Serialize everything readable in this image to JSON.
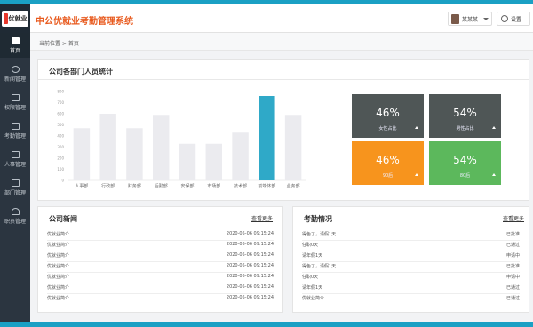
{
  "app": {
    "logo_text": "优就业",
    "title": "中公优就业考勤管理系统"
  },
  "header": {
    "user_name": "某某某",
    "settings_label": "设置"
  },
  "sidebar": {
    "items": [
      {
        "label": "首页",
        "icon": "home-icon",
        "active": true
      },
      {
        "label": "新闻管理",
        "icon": "globe-icon"
      },
      {
        "label": "权限管理",
        "icon": "lock-icon"
      },
      {
        "label": "考勤管理",
        "icon": "calendar-icon"
      },
      {
        "label": "人事管理",
        "icon": "grid-icon"
      },
      {
        "label": "部门管理",
        "icon": "download-icon"
      },
      {
        "label": "职员管理",
        "icon": "user-icon"
      }
    ]
  },
  "breadcrumb": {
    "text": "当前位置 > 首页"
  },
  "stats_panel": {
    "title": "公司各部门人员统计"
  },
  "chart_data": {
    "type": "bar",
    "categories": [
      "人事部",
      "行政部",
      "财务部",
      "后勤部",
      "安保部",
      "市场部",
      "技术部",
      "前端体部",
      "业务部"
    ],
    "values": [
      470,
      600,
      470,
      590,
      330,
      330,
      430,
      760,
      590
    ],
    "highlight_index": 7,
    "ylim": [
      0,
      800
    ],
    "yticks": [
      0,
      100,
      200,
      300,
      400,
      500,
      600,
      700,
      800
    ],
    "bar_color": "#ebebef",
    "highlight_color": "#2fa9c8",
    "grid": false
  },
  "tiles": [
    {
      "value": "46%",
      "label": "女性占比",
      "color": "#4f5656"
    },
    {
      "value": "54%",
      "label": "男性占比",
      "color": "#4f5656"
    },
    {
      "value": "46%",
      "label": "90后",
      "color": "#f7941d"
    },
    {
      "value": "54%",
      "label": "80后",
      "color": "#5cb85c"
    }
  ],
  "news_panel": {
    "title": "公司新闻",
    "more_label": "查看更多",
    "rows": [
      {
        "title": "优就业简介",
        "time": "2020-05-06  09:15:24"
      },
      {
        "title": "优就业简介",
        "time": "2020-05-06  09:15:24"
      },
      {
        "title": "优就业简介",
        "time": "2020-05-06  09:15:24"
      },
      {
        "title": "优就业简介",
        "time": "2020-05-06  09:15:24"
      },
      {
        "title": "优就业简介",
        "time": "2020-05-06  09:15:24"
      },
      {
        "title": "优就业简介",
        "time": "2020-05-06  09:15:24"
      },
      {
        "title": "优就业简介",
        "time": "2020-05-06  09:15:24"
      }
    ]
  },
  "attendance_panel": {
    "title": "考勤情况",
    "more_label": "查看更多",
    "rows": [
      {
        "title": "得色了，请假1天",
        "status": "已批准"
      },
      {
        "title": "任职0天",
        "status": "已通过"
      },
      {
        "title": "请年假1天",
        "status": "申请中"
      },
      {
        "title": "得色了，请假1天",
        "status": "已批准"
      },
      {
        "title": "任职0天",
        "status": "申请中"
      },
      {
        "title": "请年假1天",
        "status": "已通过"
      },
      {
        "title": "优就业简介",
        "status": "已通过"
      }
    ]
  }
}
